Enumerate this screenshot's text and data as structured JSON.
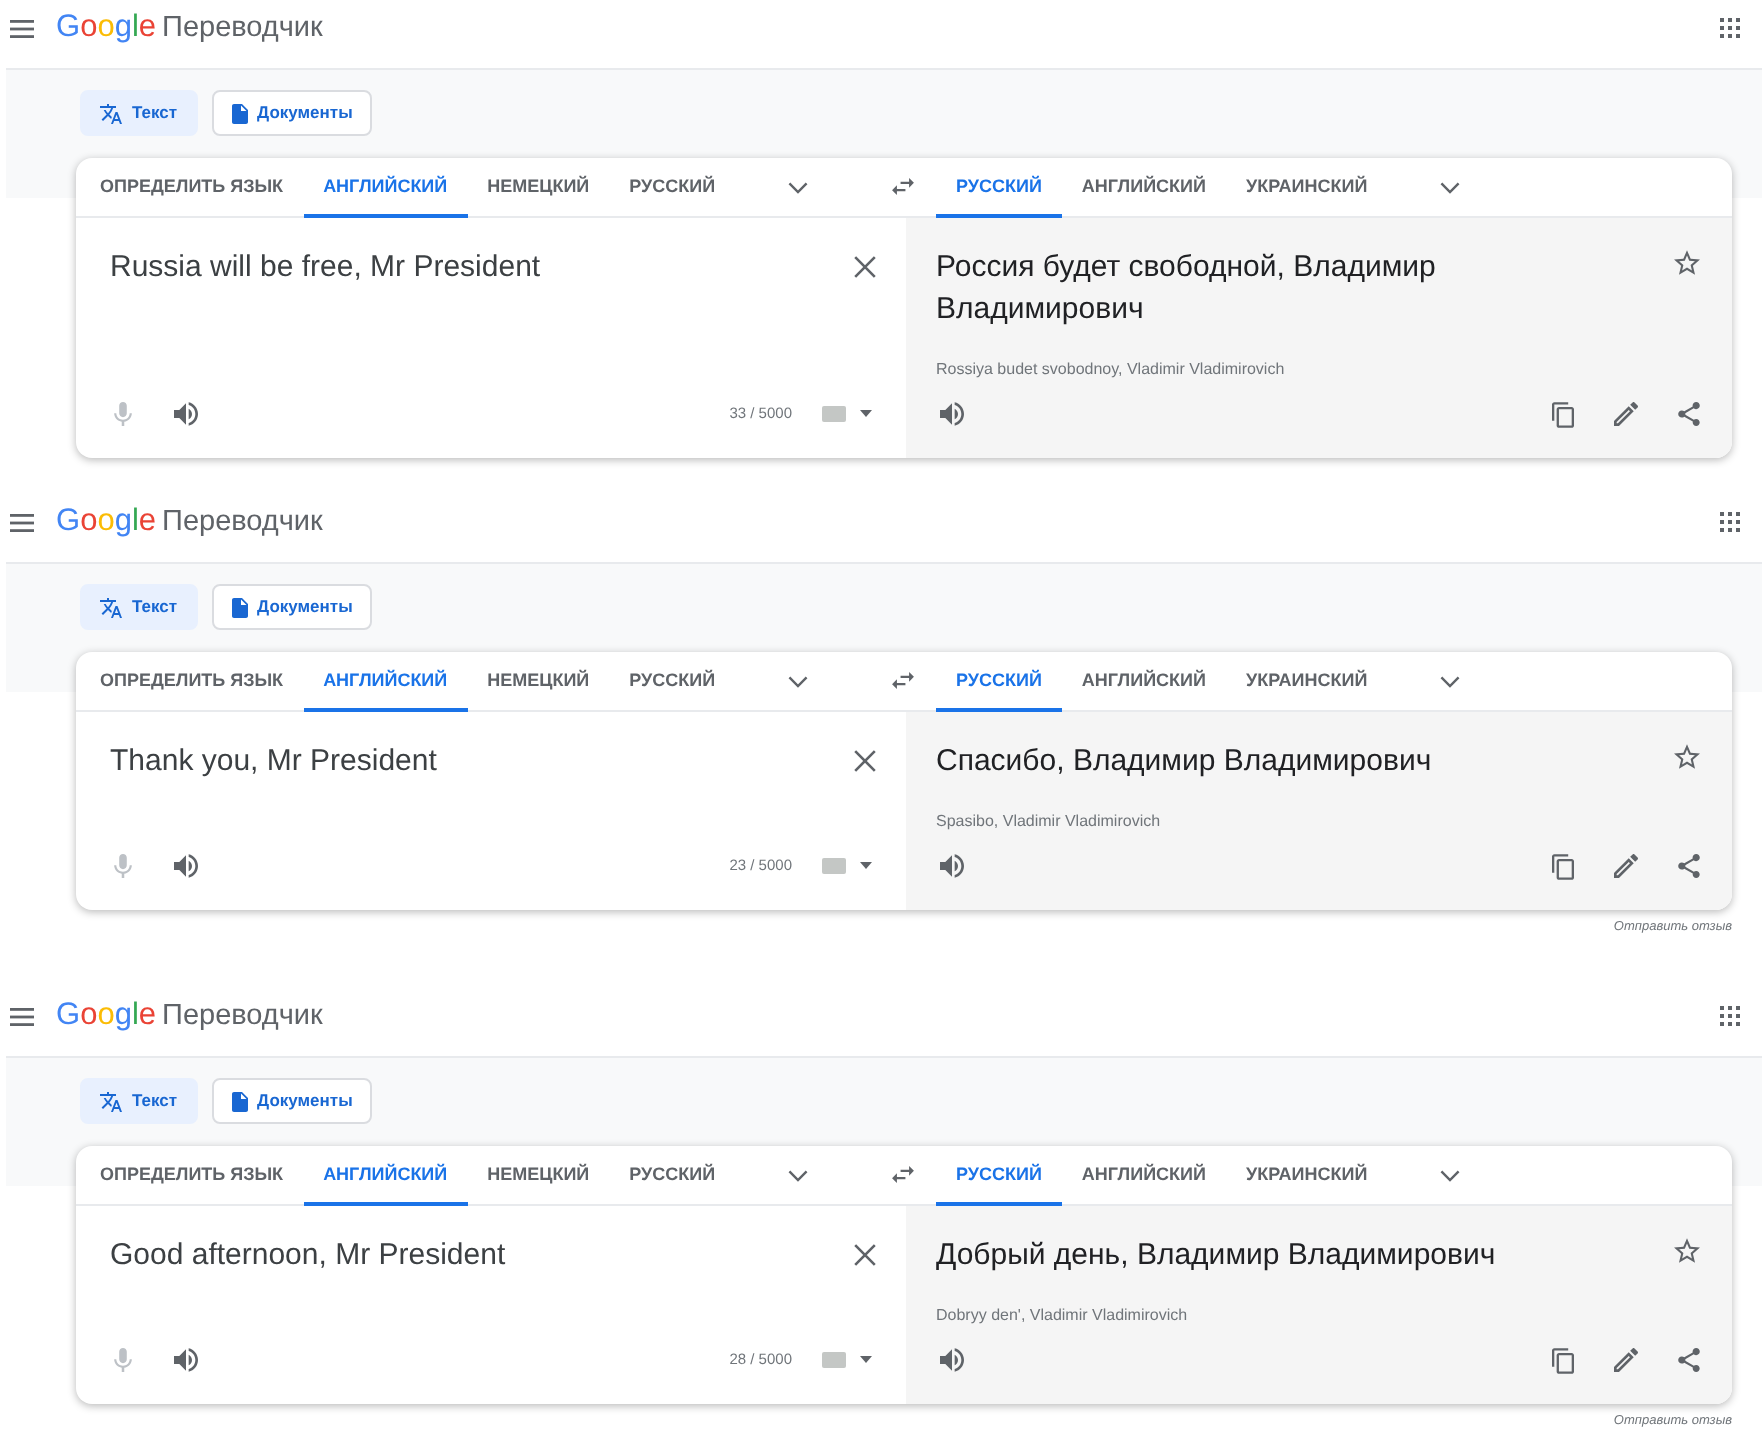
{
  "panels": [
    {
      "header": {
        "logo": "Google",
        "product": "Переводчик"
      },
      "modes": [
        {
          "kind": "text",
          "label": "Текст",
          "selected": true
        },
        {
          "kind": "documents",
          "label": "Документы",
          "selected": false
        }
      ],
      "source_languages": [
        {
          "label": "ОПРЕДЕЛИТЬ ЯЗЫК",
          "selected": false
        },
        {
          "label": "АНГЛИЙСКИЙ",
          "selected": true
        },
        {
          "label": "НЕМЕЦКИЙ",
          "selected": false
        },
        {
          "label": "РУССКИЙ",
          "selected": false
        }
      ],
      "target_languages": [
        {
          "label": "РУССКИЙ",
          "selected": true
        },
        {
          "label": "АНГЛИЙСКИЙ",
          "selected": false
        },
        {
          "label": "УКРАИНСКИЙ",
          "selected": false
        }
      ],
      "source": {
        "value": "Russia will be free, Mr President",
        "char_count": "33 / 5000"
      },
      "translation": {
        "text": "Россия будет свободной, Владимир Владимирович",
        "transliteration": "Rossiya budet svobodnoy, Vladimir Vladimirovich"
      }
    },
    {
      "header": {
        "logo": "Google",
        "product": "Переводчик"
      },
      "modes": [
        {
          "kind": "text",
          "label": "Текст",
          "selected": true
        },
        {
          "kind": "documents",
          "label": "Документы",
          "selected": false
        }
      ],
      "source_languages": [
        {
          "label": "ОПРЕДЕЛИТЬ ЯЗЫК",
          "selected": false
        },
        {
          "label": "АНГЛИЙСКИЙ",
          "selected": true
        },
        {
          "label": "НЕМЕЦКИЙ",
          "selected": false
        },
        {
          "label": "РУССКИЙ",
          "selected": false
        }
      ],
      "target_languages": [
        {
          "label": "РУССКИЙ",
          "selected": true
        },
        {
          "label": "АНГЛИЙСКИЙ",
          "selected": false
        },
        {
          "label": "УКРАИНСКИЙ",
          "selected": false
        }
      ],
      "source": {
        "value": "Thank you, Mr President",
        "char_count": "23 / 5000"
      },
      "translation": {
        "text": "Спасибо, Владимир Владимирович",
        "transliteration": "Spasibo, Vladimir Vladimirovich"
      },
      "feedback_link": "Отправить отзыв"
    },
    {
      "header": {
        "logo": "Google",
        "product": "Переводчик"
      },
      "modes": [
        {
          "kind": "text",
          "label": "Текст",
          "selected": true
        },
        {
          "kind": "documents",
          "label": "Документы",
          "selected": false
        }
      ],
      "source_languages": [
        {
          "label": "ОПРЕДЕЛИТЬ ЯЗЫК",
          "selected": false
        },
        {
          "label": "АНГЛИЙСКИЙ",
          "selected": true
        },
        {
          "label": "НЕМЕЦКИЙ",
          "selected": false
        },
        {
          "label": "РУССКИЙ",
          "selected": false
        }
      ],
      "target_languages": [
        {
          "label": "РУССКИЙ",
          "selected": true
        },
        {
          "label": "АНГЛИЙСКИЙ",
          "selected": false
        },
        {
          "label": "УКРАИНСКИЙ",
          "selected": false
        }
      ],
      "source": {
        "value": "Good afternoon, Mr President",
        "char_count": "28 / 5000"
      },
      "translation": {
        "text": "Добрый день, Владимир Владимирович",
        "transliteration": "Dobryy den', Vladimir Vladimirovich"
      },
      "feedback_link": "Отправить отзыв"
    }
  ]
}
